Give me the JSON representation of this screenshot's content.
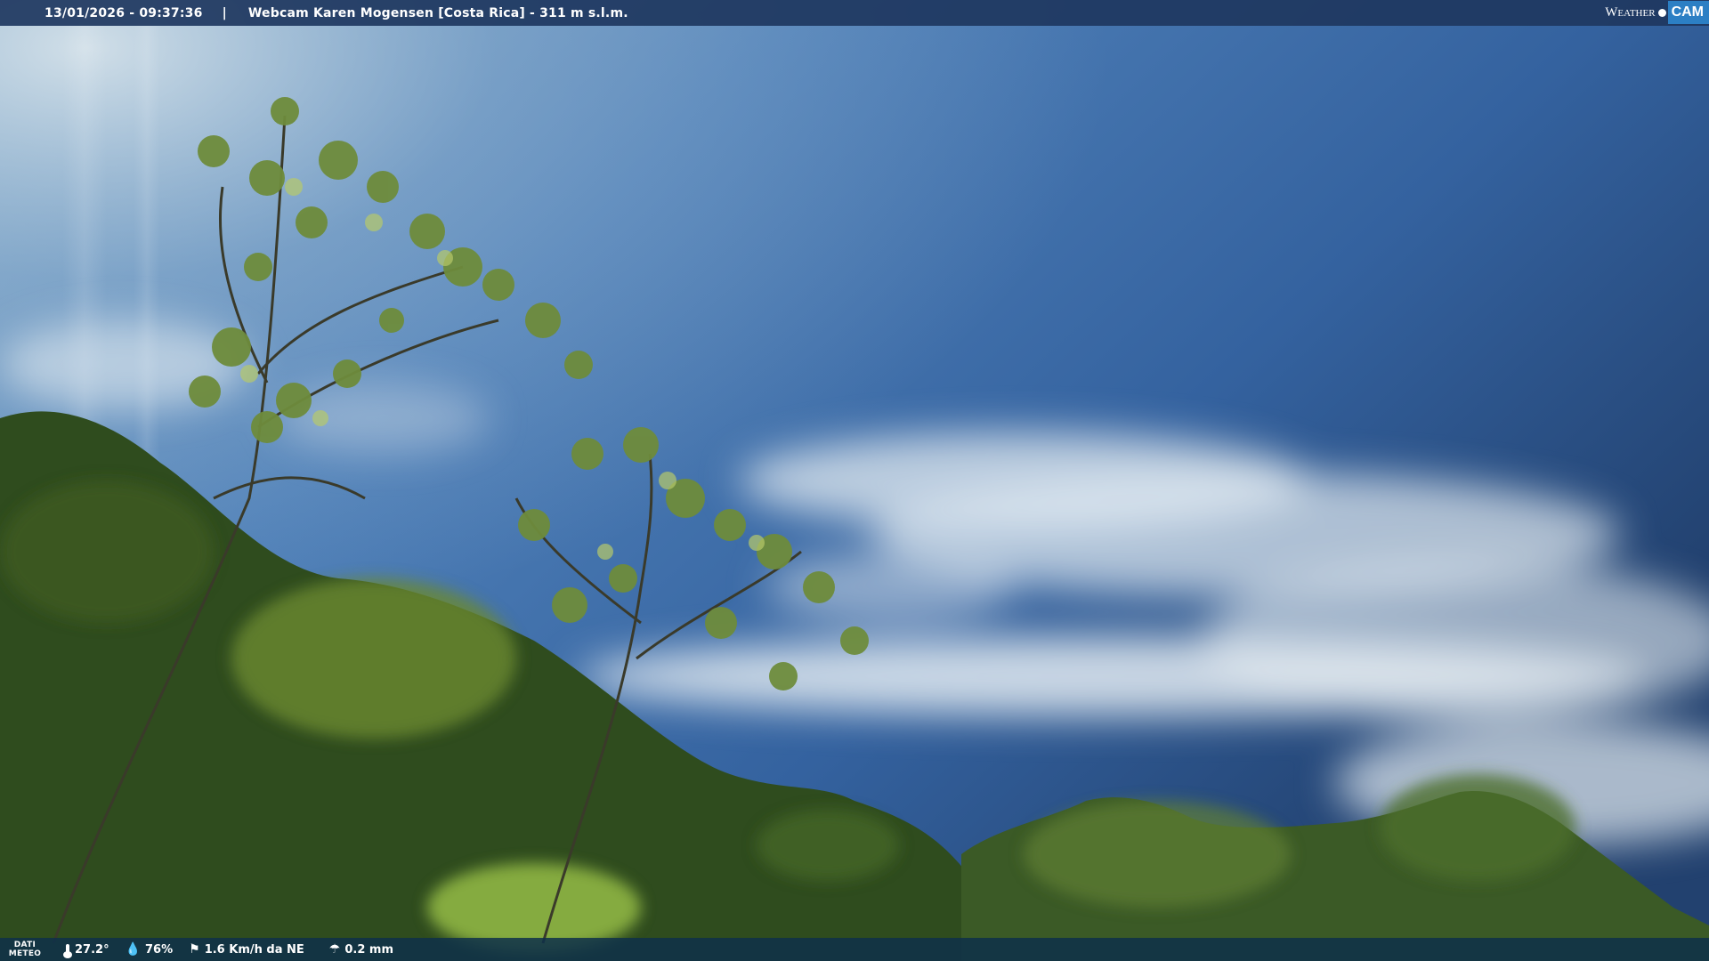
{
  "overlay": {
    "timestamp": "13/01/2026 - 09:37:36",
    "separator": "|",
    "title": "Webcam Karen Mogensen [Costa Rica] - 311 m s.l.m."
  },
  "logo": {
    "weather_text": "Weather",
    "cam_text": "CAM"
  },
  "weather": {
    "label_line1": "DATI",
    "label_line2": "METEO",
    "temperature": "27.2°",
    "humidity": "76%",
    "wind": "1.6 Km/h da NE",
    "rain": "0.2 mm",
    "icons": {
      "temperature": "thermometer-icon",
      "humidity": "drop-icon",
      "wind": "windsock-icon",
      "rain": "rain-gauge-icon"
    }
  }
}
